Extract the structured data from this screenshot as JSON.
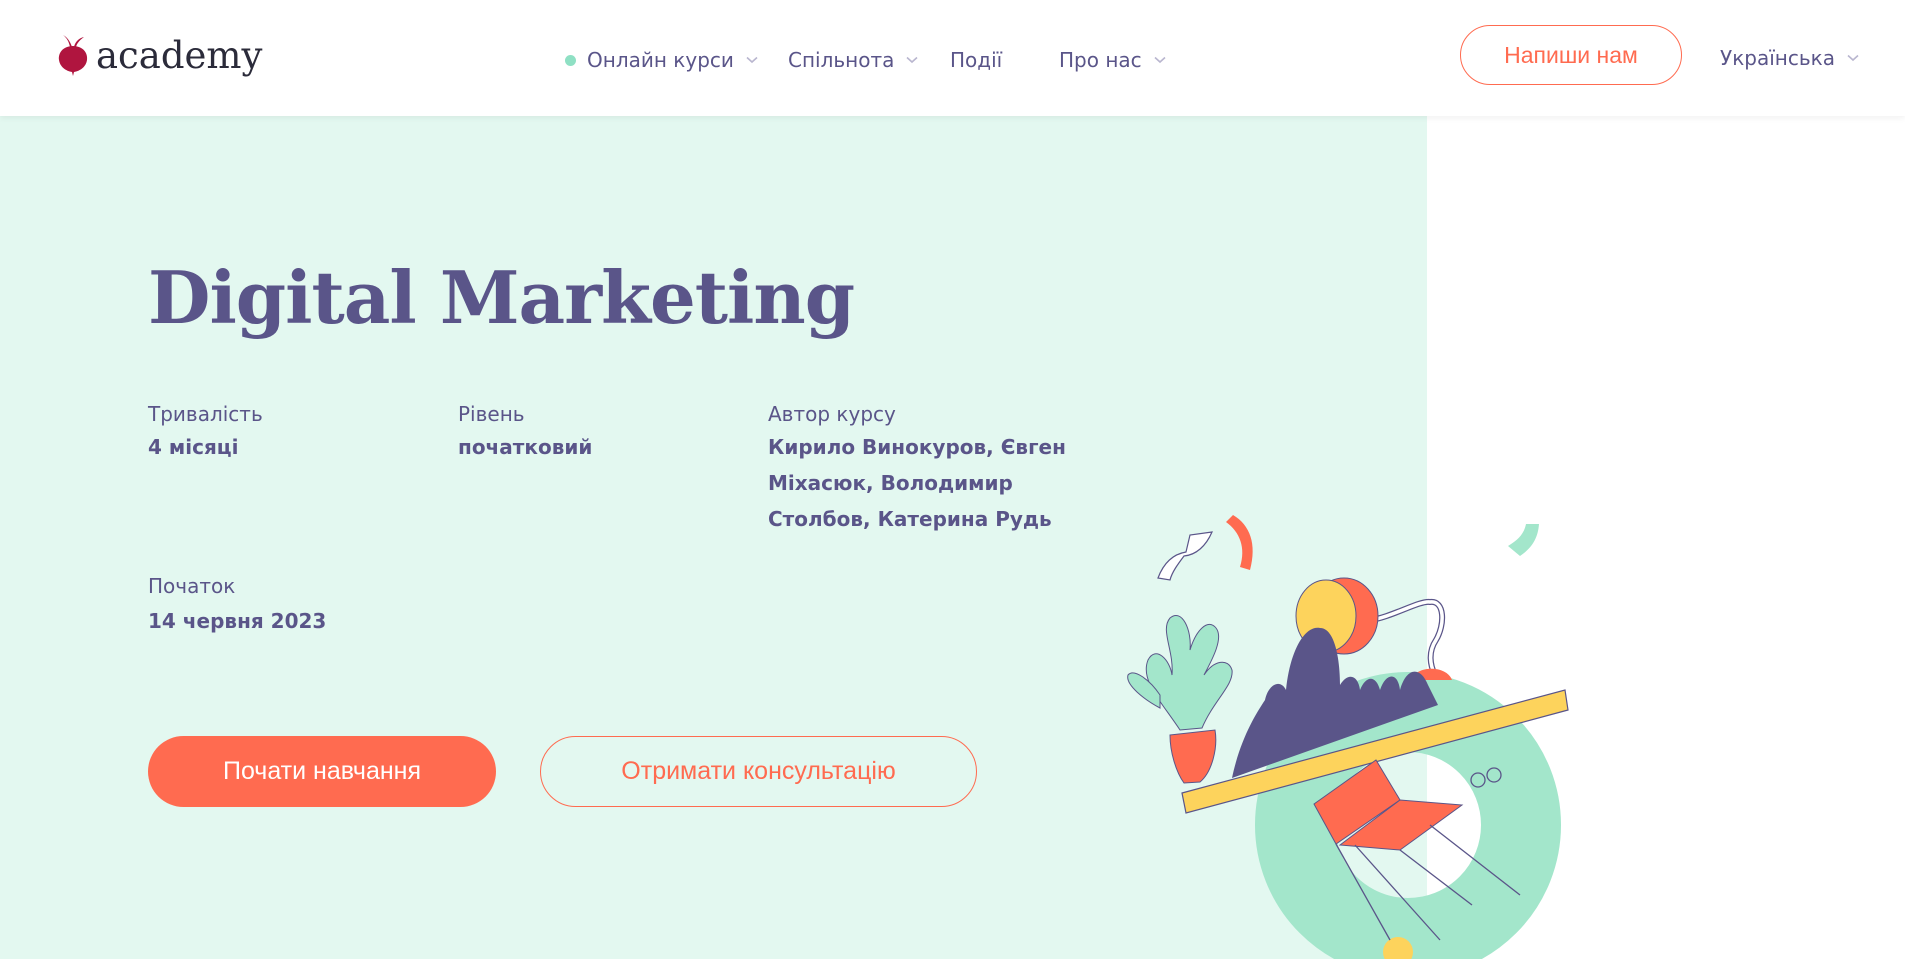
{
  "header": {
    "logo_text": "academy",
    "nav": [
      {
        "label": "Онлайн курси",
        "has_dot": true,
        "has_dropdown": true
      },
      {
        "label": "Спільнота",
        "has_dropdown": true
      },
      {
        "label": "Події",
        "has_dropdown": false
      },
      {
        "label": "Про нас",
        "has_dropdown": true
      }
    ],
    "contact_button": "Напиши нам",
    "language": "Українська"
  },
  "hero": {
    "title": "Digital Marketing",
    "duration": {
      "label": "Тривалість",
      "value": "4 місяці"
    },
    "level": {
      "label": "Рівень",
      "value": "початковий"
    },
    "author": {
      "label": "Автор курсу",
      "lines": [
        "Кирило Винокуров, Євген",
        "Міхасюк, Володимир",
        "Столбов, Катерина Рудь"
      ]
    },
    "start": {
      "label": "Початок",
      "value": "14 червня 2023"
    },
    "primary_button": "Почати навчання",
    "secondary_button": "Отримати консультацію"
  },
  "colors": {
    "accent": "#ff6b50",
    "text": "#5a5589",
    "hero_bg": "#e3f8f0",
    "mint": "#a3e6cb",
    "yellow": "#fdd35c",
    "logo": "#b0153f"
  },
  "icons": [
    "beet-logo-icon",
    "chevron-down-icon",
    "nav-dot-icon"
  ]
}
